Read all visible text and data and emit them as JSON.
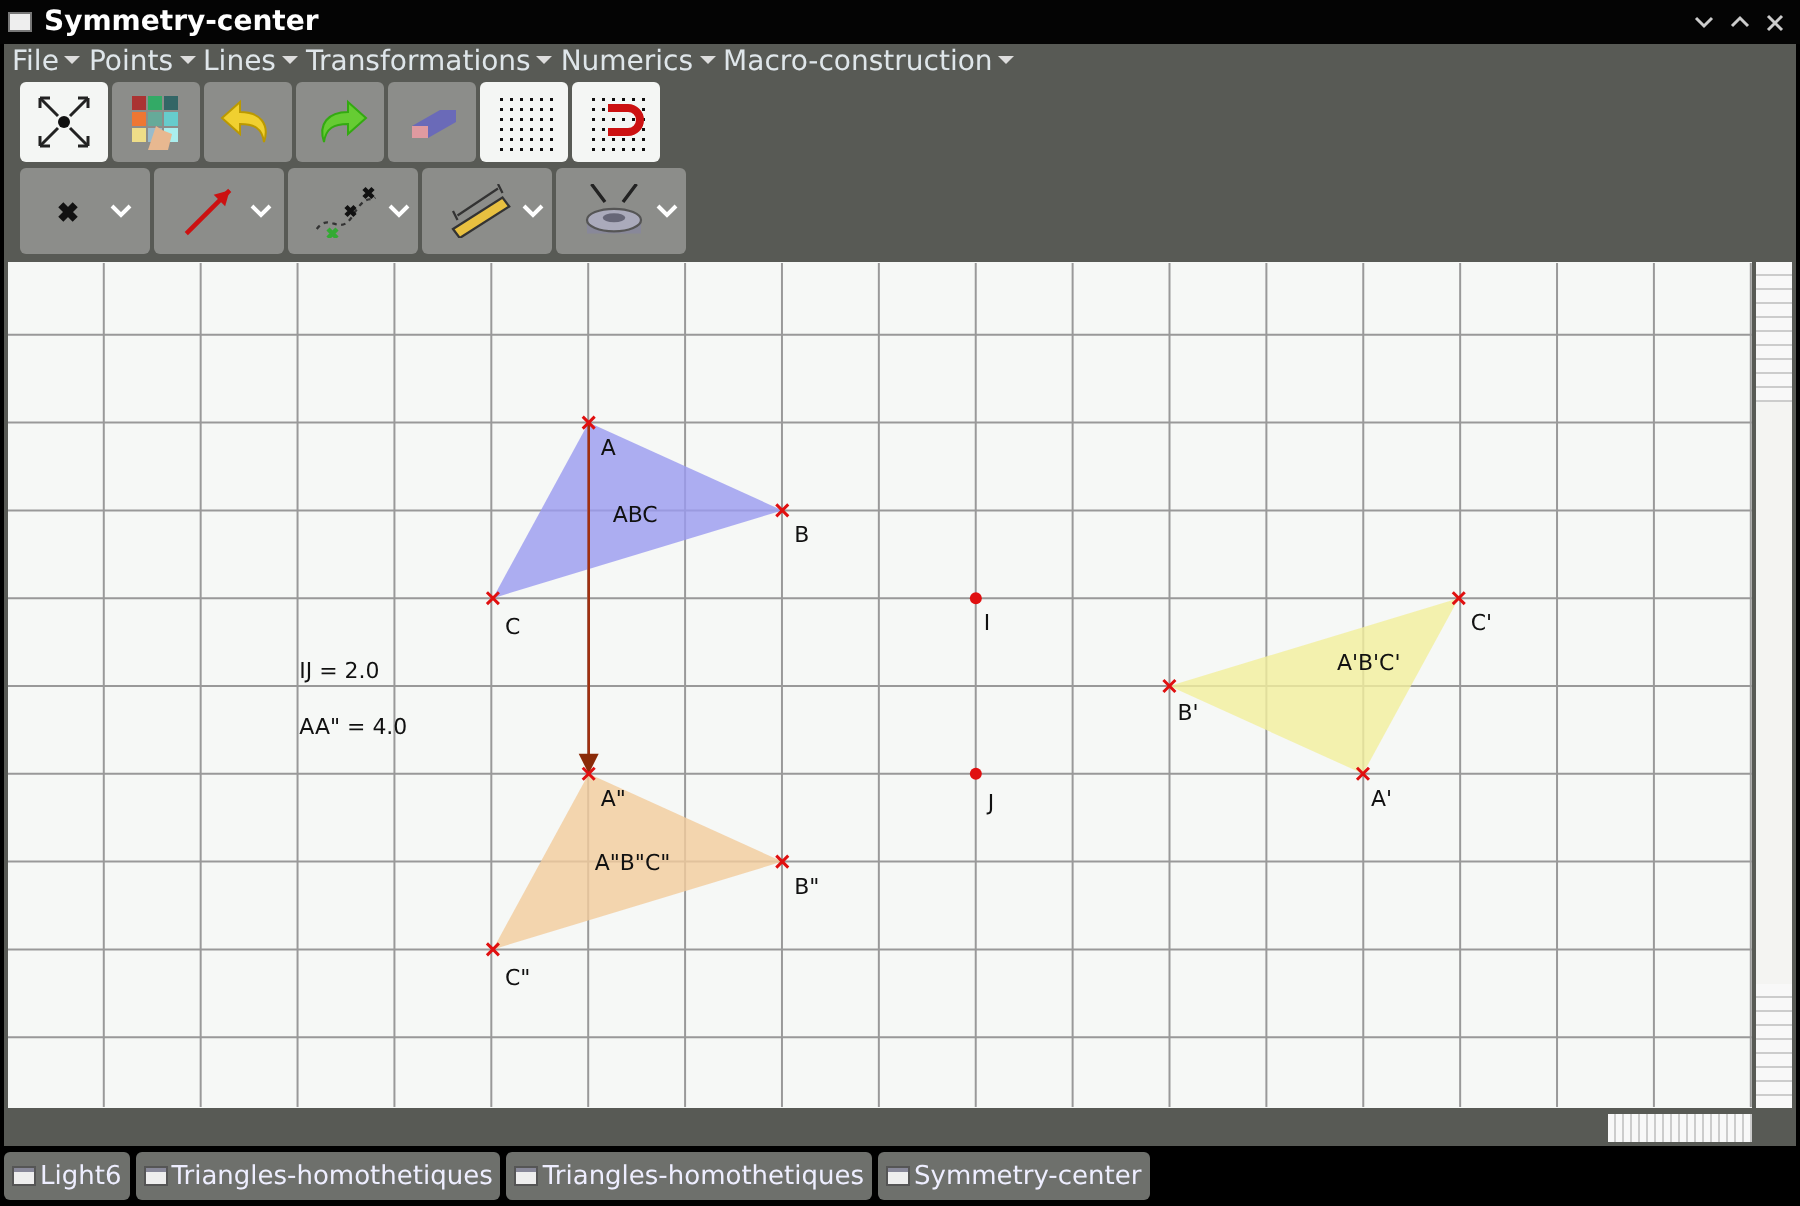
{
  "window": {
    "title": "Symmetry-center"
  },
  "menu": [
    "File",
    "Points",
    "Lines",
    "Transformations",
    "Numerics",
    "Macro-construction"
  ],
  "toolbar": [
    {
      "kind": "move",
      "on": true
    },
    {
      "kind": "palette",
      "on": false
    },
    {
      "kind": "undo",
      "on": false
    },
    {
      "kind": "redo",
      "on": false
    },
    {
      "kind": "eraser",
      "on": false
    },
    {
      "kind": "grid",
      "on": true
    },
    {
      "kind": "magnet",
      "on": true
    }
  ],
  "tools": [
    {
      "kind": "point"
    },
    {
      "kind": "vector"
    },
    {
      "kind": "curve"
    },
    {
      "kind": "ruler"
    },
    {
      "kind": "gear"
    }
  ],
  "canvas": {
    "points": [
      {
        "label": "A",
        "kind": "cross"
      },
      {
        "label": "B",
        "kind": "cross"
      },
      {
        "label": "C",
        "kind": "cross"
      },
      {
        "label": "I",
        "kind": "dot"
      },
      {
        "label": "C'",
        "kind": "cross"
      },
      {
        "label": "B'",
        "kind": "cross"
      },
      {
        "label": "A\"",
        "kind": "cross"
      },
      {
        "label": "J",
        "kind": "dot"
      },
      {
        "label": "A'",
        "kind": "cross"
      },
      {
        "label": "B\"",
        "kind": "cross"
      },
      {
        "label": "C\"",
        "kind": "cross"
      }
    ],
    "triangles": [
      {
        "label": "ABC",
        "color": "#9a9af0"
      },
      {
        "label": "A\"B\"C\"",
        "color": "#f3cc9c"
      },
      {
        "label": "A'B'C'",
        "color": "#f3ef9c"
      }
    ],
    "measures": [
      "IJ = 2.0",
      "AA\" = 4.0"
    ]
  },
  "taskbar": [
    "Light6",
    "Triangles-homothetiques",
    "Triangles-homothetiques",
    "Symmetry-center"
  ]
}
